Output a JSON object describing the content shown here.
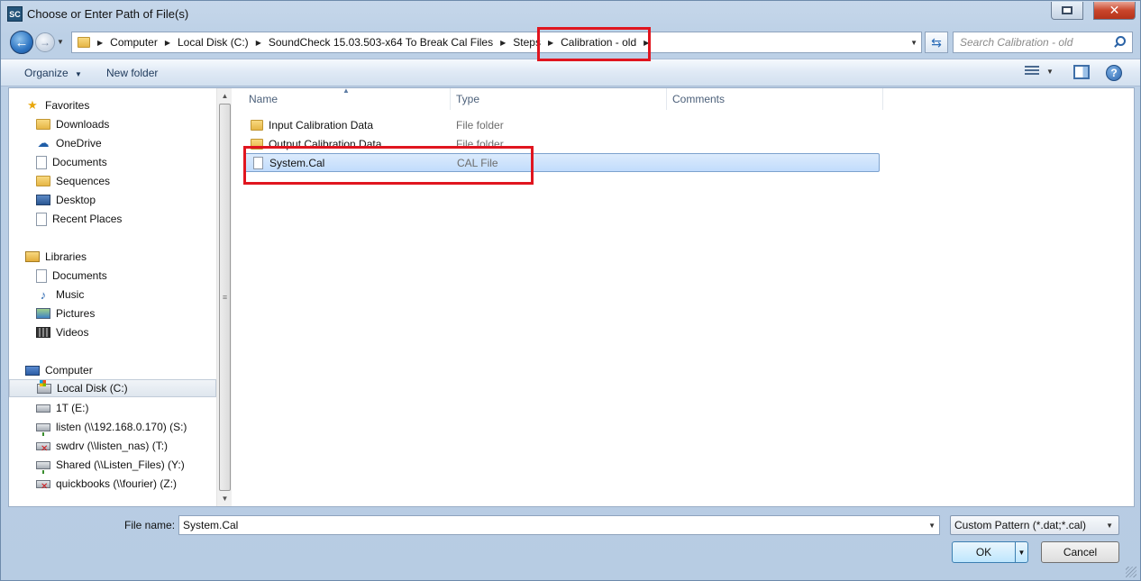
{
  "window": {
    "title": "Choose or Enter Path of File(s)",
    "app_icon_text": "SC"
  },
  "address_bar": {
    "crumbs": [
      "Computer",
      "Local Disk (C:)",
      "SoundCheck 15.03.503-x64 To Break Cal Files",
      "Steps",
      "Calibration - old"
    ]
  },
  "search": {
    "placeholder": "Search Calibration - old"
  },
  "toolbar": {
    "organize_label": "Organize",
    "new_folder_label": "New folder"
  },
  "nav": {
    "favorites": {
      "label": "Favorites",
      "items": [
        "Downloads",
        "OneDrive",
        "Documents",
        "Sequences",
        "Desktop",
        "Recent Places"
      ]
    },
    "libraries": {
      "label": "Libraries",
      "items": [
        "Documents",
        "Music",
        "Pictures",
        "Videos"
      ]
    },
    "computer": {
      "label": "Computer",
      "items": [
        "Local Disk (C:)",
        "1T (E:)",
        "listen (\\\\192.168.0.170) (S:)",
        "swdrv (\\\\listen_nas) (T:)",
        "Shared (\\\\Listen_Files) (Y:)",
        "quickbooks (\\\\fourier) (Z:)"
      ],
      "selected": "Local Disk (C:)"
    }
  },
  "file_list": {
    "columns": [
      "Name",
      "Type",
      "Comments"
    ],
    "rows": [
      {
        "name": "Input Calibration Data",
        "type": "File folder"
      },
      {
        "name": "Output Calibration Data",
        "type": "File folder"
      },
      {
        "name": "System.Cal",
        "type": "CAL File"
      }
    ],
    "selected": "System.Cal"
  },
  "footer": {
    "file_name_label": "File name:",
    "file_name_value": "System.Cal",
    "filter_value": "Custom Pattern (*.dat;*.cal)",
    "ok_label": "OK",
    "cancel_label": "Cancel"
  },
  "colors": {
    "annotation": "#e0151f",
    "selection": "#c1dcfc"
  }
}
